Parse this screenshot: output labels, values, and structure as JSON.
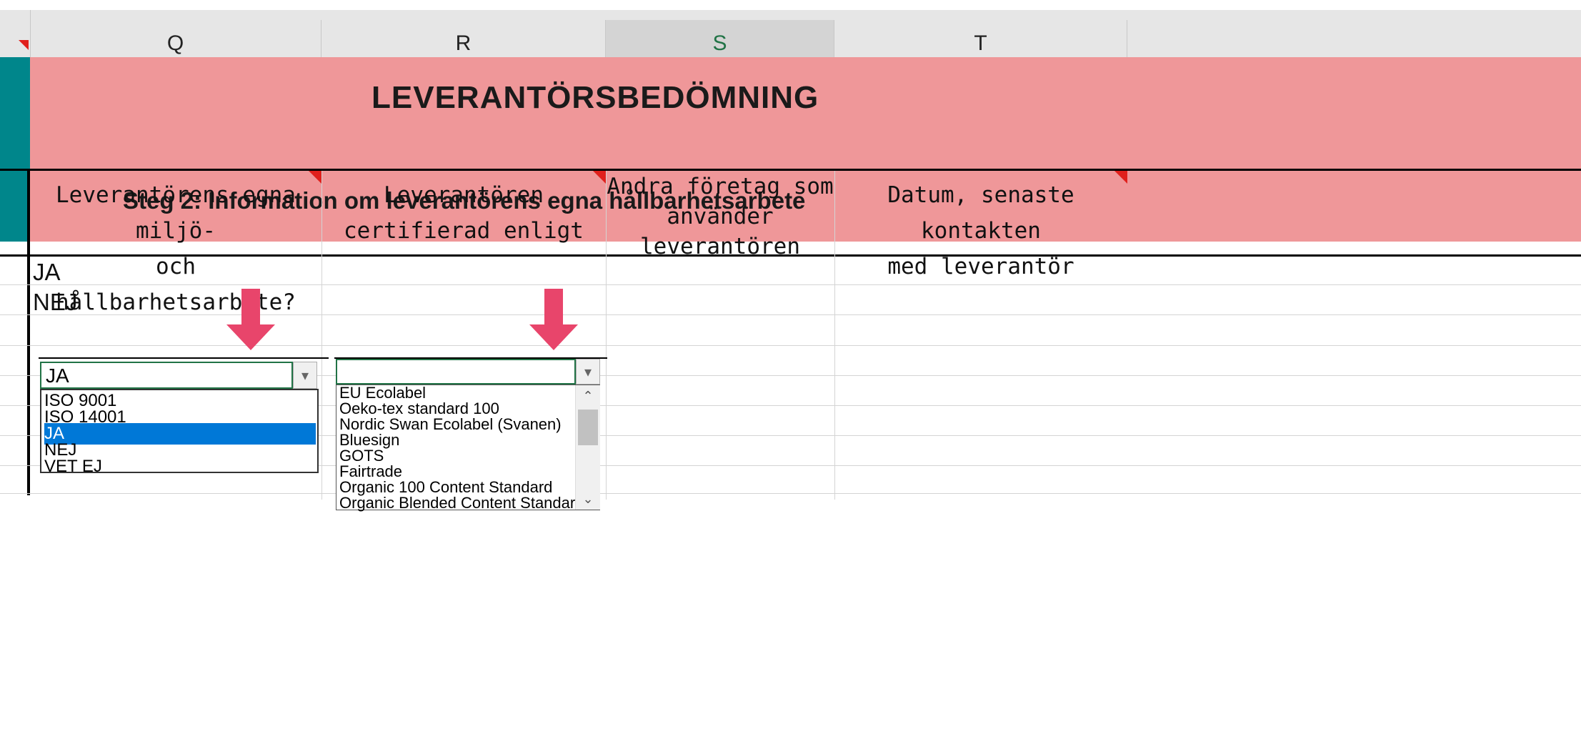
{
  "columns": [
    "Q",
    "R",
    "S",
    "T"
  ],
  "selected_column": "S",
  "banner": {
    "title": "LEVERANTÖRSBEDÖMNING",
    "subtitle": "Steg 2: Information om leverantörens egna hållbarhetsarbete"
  },
  "headers": {
    "q": [
      "Leverantörens egna miljö-",
      "och hållbarhetsarbete?"
    ],
    "r": [
      "Leverantören",
      "certifierad enligt"
    ],
    "s": [
      "Andra företag som",
      "använder",
      "leverantören"
    ],
    "t": [
      "Datum, senaste kontakten",
      "med leverantör"
    ]
  },
  "cells": {
    "q1": "JA",
    "q2": "NEJ"
  },
  "dropdown_q": {
    "value": "JA",
    "options": [
      "ISO 9001",
      "ISO 14001",
      "JA",
      "NEJ",
      "VET EJ"
    ],
    "highlighted": "JA"
  },
  "dropdown_r": {
    "value": "",
    "options": [
      "EU Ecolabel",
      "Oeko-tex standard 100",
      "Nordic Swan Ecolabel (Svanen)",
      "Bluesign",
      "GOTS",
      "Fairtrade",
      "Organic 100 Content Standard",
      "Organic Blended Content Standard"
    ]
  },
  "icons": {
    "dropdown_arrow": "chevron-down-icon",
    "scroll_up": "chevron-up-icon",
    "scroll_down": "chevron-down-icon"
  },
  "colors": {
    "banner": "#ef9799",
    "accent_teal": "#00868b",
    "arrow": "#e8456b",
    "selection": "#0078d7",
    "excel_green": "#217346"
  }
}
